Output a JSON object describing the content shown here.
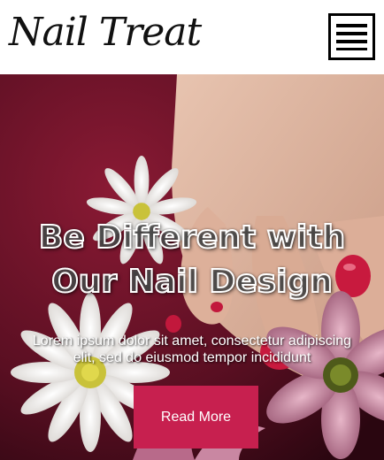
{
  "header": {
    "logo_text": "Nail Treat",
    "menu_icon": "hamburger-menu-icon"
  },
  "hero": {
    "title_line1": "Be Different with",
    "title_line2": "Our Nail Design",
    "subtitle": "Lorem ipsum dolor sit amet, consectetur adipiscing elit, sed do eiusmod tempor incididunt",
    "button_label": "Read More"
  },
  "colors": {
    "accent": "#c7204f",
    "header_bg": "#ffffff",
    "text": "#111111"
  }
}
